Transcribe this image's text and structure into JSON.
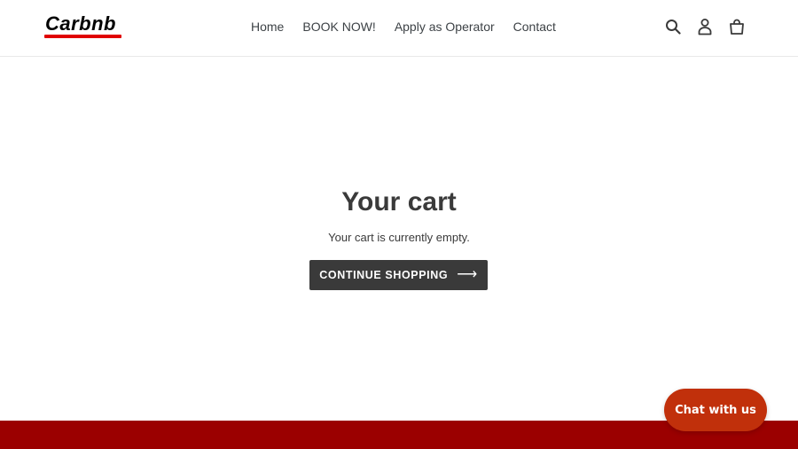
{
  "brand": {
    "logo_text": "Carbnb",
    "logo_accent": "#e00000"
  },
  "nav": {
    "items": [
      {
        "label": "Home"
      },
      {
        "label": "BOOK NOW!"
      },
      {
        "label": "Apply as Operator"
      },
      {
        "label": "Contact"
      }
    ]
  },
  "header_icons": [
    "search-icon",
    "account-icon",
    "cart-icon"
  ],
  "cart": {
    "title": "Your cart",
    "empty_message": "Your cart is currently empty.",
    "continue_label": "CONTINUE SHOPPING",
    "continue_arrow": "⟶"
  },
  "chat": {
    "label": "Chat with us",
    "color": "#c1300b"
  },
  "colors": {
    "footer": "#9b0000",
    "button_bg": "#3a3a3a",
    "text": "#3a3a3a"
  }
}
